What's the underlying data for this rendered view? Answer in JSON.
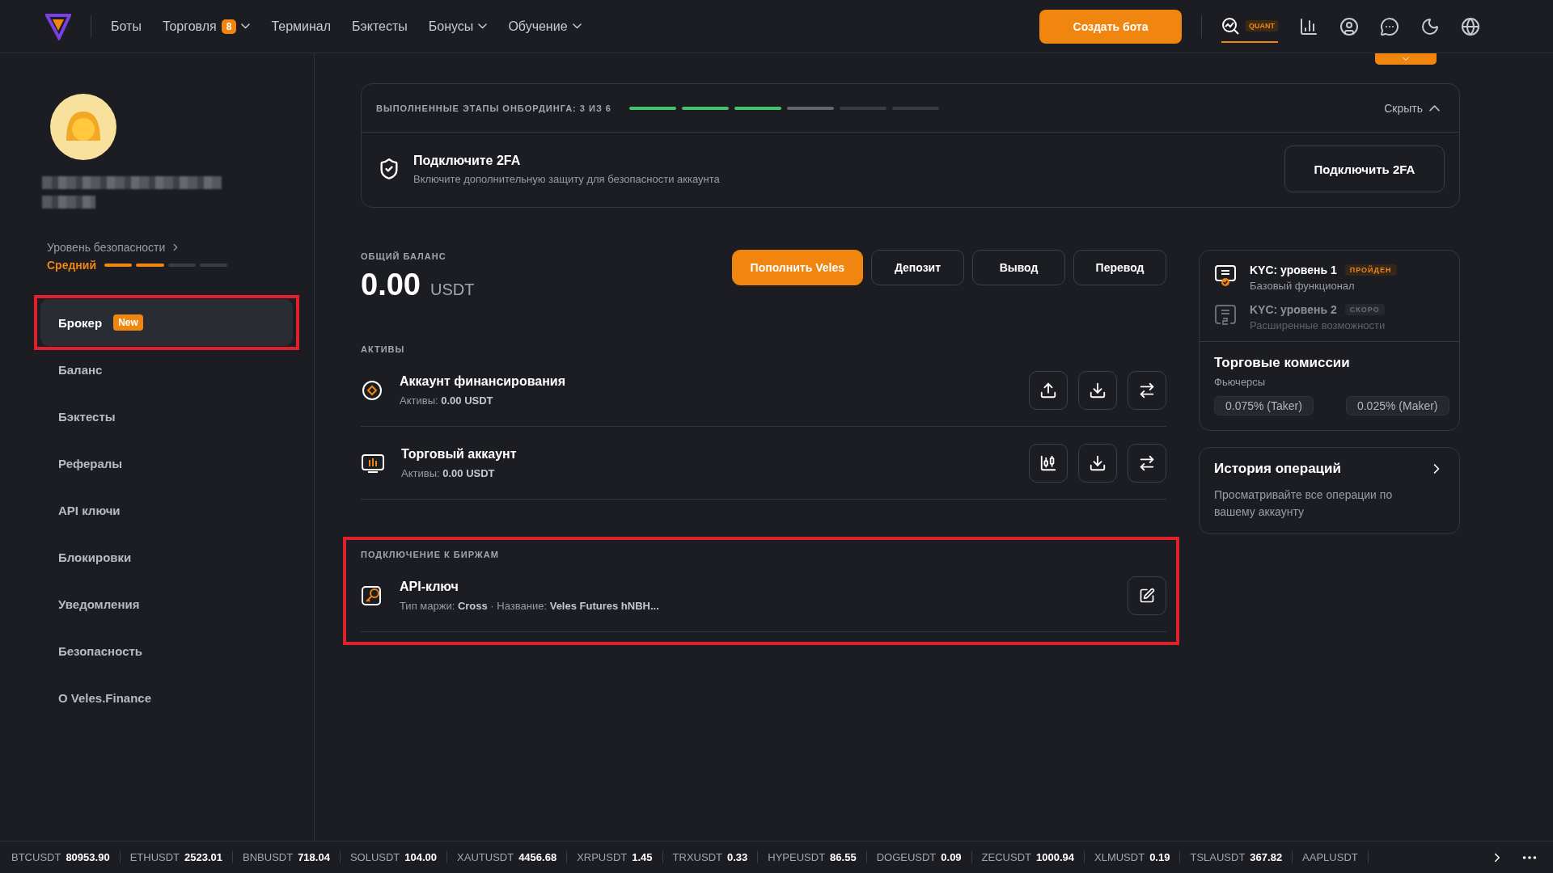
{
  "nav": {
    "items": [
      {
        "label": "Боты",
        "dropdown": false
      },
      {
        "label": "Торговля",
        "badge": "8",
        "dropdown": true
      },
      {
        "label": "Терминал",
        "dropdown": false
      },
      {
        "label": "Бэктесты",
        "dropdown": false
      },
      {
        "label": "Бонусы",
        "dropdown": true
      },
      {
        "label": "Обучение",
        "dropdown": true
      }
    ],
    "create_button": "Создать бота",
    "quant_label": "QUANT"
  },
  "profile": {
    "security_label": "Уровень безопасности",
    "security_value": "Средний",
    "level": 0.5
  },
  "menu": [
    {
      "label": "Брокер",
      "badge": "New",
      "selected": true,
      "highlighted": true
    },
    {
      "label": "Баланс",
      "selected": false,
      "highlighted": false
    },
    {
      "label": "Бэктесты",
      "selected": false,
      "highlighted": false
    },
    {
      "label": "Рефералы",
      "selected": false,
      "highlighted": false
    },
    {
      "label": "API ключи",
      "selected": false,
      "highlighted": false
    },
    {
      "label": "Блокировки",
      "selected": false,
      "highlighted": false
    },
    {
      "label": "Уведомления",
      "selected": false,
      "highlighted": false
    },
    {
      "label": "Безопасность",
      "selected": false,
      "highlighted": false
    },
    {
      "label": "О Veles.Finance",
      "selected": false,
      "highlighted": false
    }
  ],
  "onboarding": {
    "title": "ВЫПОЛНЕННЫЕ ЭТАПЫ ОНБОРДИНГА: 3 ИЗ 6",
    "hide_label": "Скрыть",
    "expanded": true,
    "steps": [
      {
        "done": true,
        "current": false
      },
      {
        "done": true,
        "current": false
      },
      {
        "done": true,
        "current": false
      },
      {
        "done": false,
        "current": true
      },
      {
        "done": false,
        "current": false
      },
      {
        "done": false,
        "current": false
      }
    ],
    "task": {
      "title": "Подключите 2FA",
      "description": "Включите дополнительную защиту для безопасности аккаунта",
      "button": "Подключить 2FA"
    }
  },
  "balance": {
    "label": "ОБЩИЙ БАЛАНС",
    "amount": "0.00",
    "currency": "USDT",
    "buttons": [
      {
        "label": "Пополнить Veles",
        "primary": true
      },
      {
        "label": "Депозит",
        "primary": false
      },
      {
        "label": "Вывод",
        "primary": false
      },
      {
        "label": "Перевод",
        "primary": false
      }
    ]
  },
  "assets": {
    "label": "АКТИВЫ",
    "rows": [
      {
        "kind": "funding",
        "name": "Аккаунт финансирования",
        "assets_label": "Активы:",
        "amount": "0.00 USDT",
        "actions": [
          {
            "kind": "upload"
          },
          {
            "kind": "download"
          },
          {
            "kind": "transfer"
          }
        ]
      },
      {
        "kind": "trading",
        "name": "Торговый аккаунт",
        "assets_label": "Активы:",
        "amount": "0.00 USDT",
        "actions": [
          {
            "kind": "candles"
          },
          {
            "kind": "download"
          },
          {
            "kind": "transfer"
          }
        ]
      }
    ]
  },
  "exchanges": {
    "label": "ПОДКЛЮЧЕНИЕ К БИРЖАМ",
    "highlighted": true,
    "rows": [
      {
        "title": "API-ключ",
        "margin_label": "Тип маржи:",
        "margin": "Cross",
        "separator": "·",
        "name_label": "Название:",
        "name": "Veles Futures hNBH..."
      }
    ]
  },
  "kyc": [
    {
      "title": "KYC: уровень 1",
      "badge": "ПРОЙДЕН",
      "description": "Базовый функционал",
      "passed": true
    },
    {
      "title": "KYC: уровень 2",
      "badge": "СКОРО",
      "description": "Расширенные возможности",
      "passed": false
    }
  ],
  "fees": {
    "title": "Торговые комиссии",
    "subtitle": "Фьючерсы",
    "values": [
      "0.075% (Taker)",
      "0.025% (Maker)"
    ]
  },
  "history": {
    "title": "История операций",
    "description": "Просматривайте все операции по вашему аккаунту"
  },
  "ticker": [
    {
      "symbol": "BTCUSDT",
      "price": "80953.90"
    },
    {
      "symbol": "ETHUSDT",
      "price": "2523.01"
    },
    {
      "symbol": "BNBUSDT",
      "price": "718.04"
    },
    {
      "symbol": "SOLUSDT",
      "price": "104.00"
    },
    {
      "symbol": "XAUTUSDT",
      "price": "4456.68"
    },
    {
      "symbol": "XRPUSDT",
      "price": "1.45"
    },
    {
      "symbol": "TRXUSDT",
      "price": "0.33"
    },
    {
      "symbol": "HYPEUSDT",
      "price": "86.55"
    },
    {
      "symbol": "DOGEUSDT",
      "price": "0.09"
    },
    {
      "symbol": "ZECUSDT",
      "price": "1000.94"
    },
    {
      "symbol": "XLMUSDT",
      "price": "0.19"
    },
    {
      "symbol": "TSLAUSDT",
      "price": "367.82"
    },
    {
      "symbol": "AAPLUSDT"
    }
  ]
}
